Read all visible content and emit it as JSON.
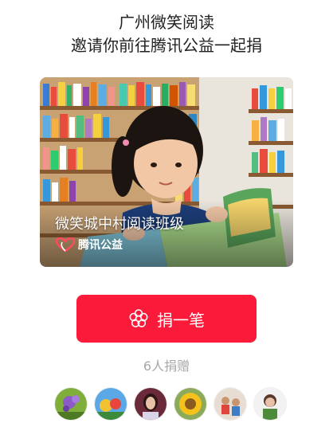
{
  "header": {
    "line1": "广州微笑阅读",
    "line2": "邀请你前往腾讯公益一起捐"
  },
  "card": {
    "project_title": "微笑城中村阅读班级",
    "brand_label": "腾讯公益",
    "image": "girl-reading-book-in-library"
  },
  "donate_button": {
    "label": "捐一笔",
    "icon": "flower-icon",
    "color": "#fc1a3a"
  },
  "donors": {
    "count_text": "6人捐赠",
    "avatars": [
      "purple-flower",
      "cartoon-characters",
      "woman-portrait",
      "sunflower",
      "children-playing",
      "child-portrait"
    ]
  }
}
